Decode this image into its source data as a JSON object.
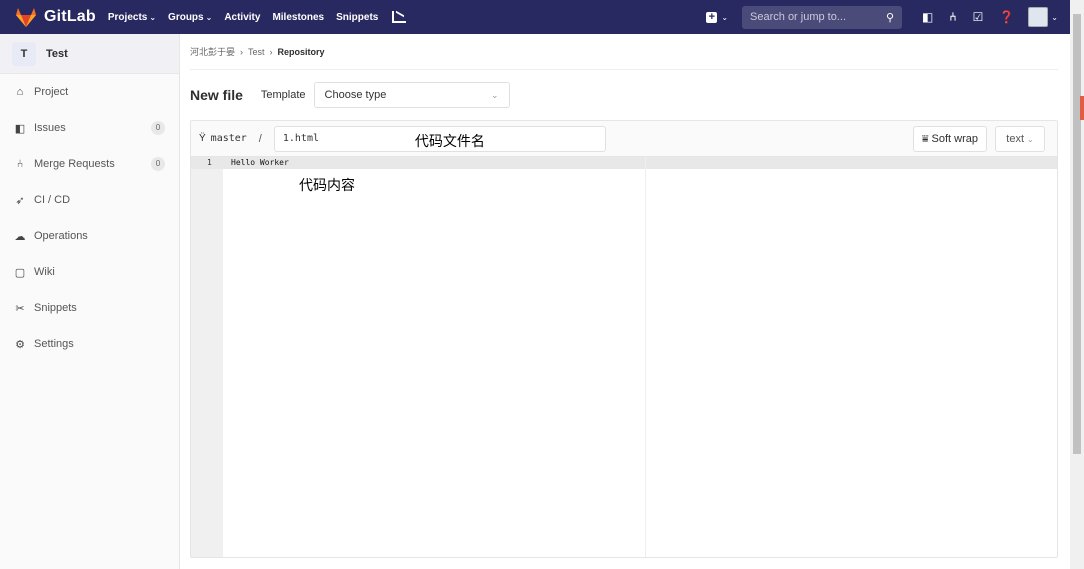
{
  "navbar": {
    "logo_text": "GitLab",
    "links": [
      {
        "label": "Projects",
        "caret": "⌄"
      },
      {
        "label": "Groups",
        "caret": "⌄"
      },
      {
        "label": "Activity",
        "caret": ""
      },
      {
        "label": "Milestones",
        "caret": ""
      },
      {
        "label": "Snippets",
        "caret": ""
      }
    ],
    "search_placeholder": "Search or jump to...",
    "colors": {
      "bar": "#292961",
      "logo": "#e24329"
    }
  },
  "sidebar": {
    "project_letter": "T",
    "project_name": "Test",
    "items": [
      {
        "label": "Project",
        "icon": "home-icon",
        "badge": ""
      },
      {
        "label": "Issues",
        "icon": "issues-icon",
        "badge": "0"
      },
      {
        "label": "Merge Requests",
        "icon": "merge-request-icon",
        "badge": "0"
      },
      {
        "label": "CI / CD",
        "icon": "rocket-icon",
        "badge": ""
      },
      {
        "label": "Operations",
        "icon": "operations-icon",
        "badge": ""
      },
      {
        "label": "Wiki",
        "icon": "book-icon",
        "badge": ""
      },
      {
        "label": "Snippets",
        "icon": "scissors-icon",
        "badge": ""
      },
      {
        "label": "Settings",
        "icon": "gear-icon",
        "badge": ""
      }
    ]
  },
  "breadcrumb": {
    "group": "河北彭于晏",
    "project": "Test",
    "current": "Repository"
  },
  "editor_page": {
    "title": "New file",
    "template_label": "Template",
    "template_value": "Choose type",
    "branch": "master",
    "path_separator": "/",
    "filename": "1.html",
    "filename_annotation": "代码文件名",
    "soft_wrap_label": "Soft wrap",
    "mode_label": "text",
    "line_number": "1",
    "line_content": "Hello Worker",
    "code_annotation": "代码内容"
  }
}
